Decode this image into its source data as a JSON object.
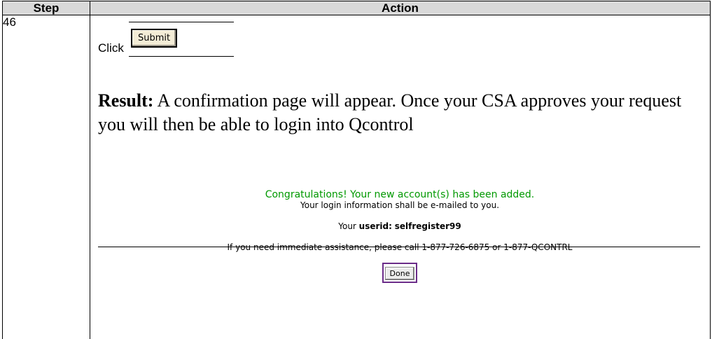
{
  "table": {
    "header_step": "Step",
    "header_action": "Action",
    "step_number": "46"
  },
  "action": {
    "click_word": "Click",
    "submit_label": "Submit",
    "result_label": "Result:",
    "result_text": "  A confirmation page will appear.  Once your CSA approves your request you will then be able to login into Qcontrol"
  },
  "confirmation": {
    "congrats": "Congratulations! Your new account(s) has been added.",
    "login_info": "Your login information shall be e-mailed to you.",
    "userid_prefix": "Your ",
    "userid_label": "userid:",
    "userid_value": "selfregister99",
    "help_text": "If you need immediate assistance, please call 1-877-726-6875 or 1-877-QCONTRL",
    "done_label": "Done",
    "congrats_color": "#009900",
    "done_border_color": "#6b2c89"
  }
}
